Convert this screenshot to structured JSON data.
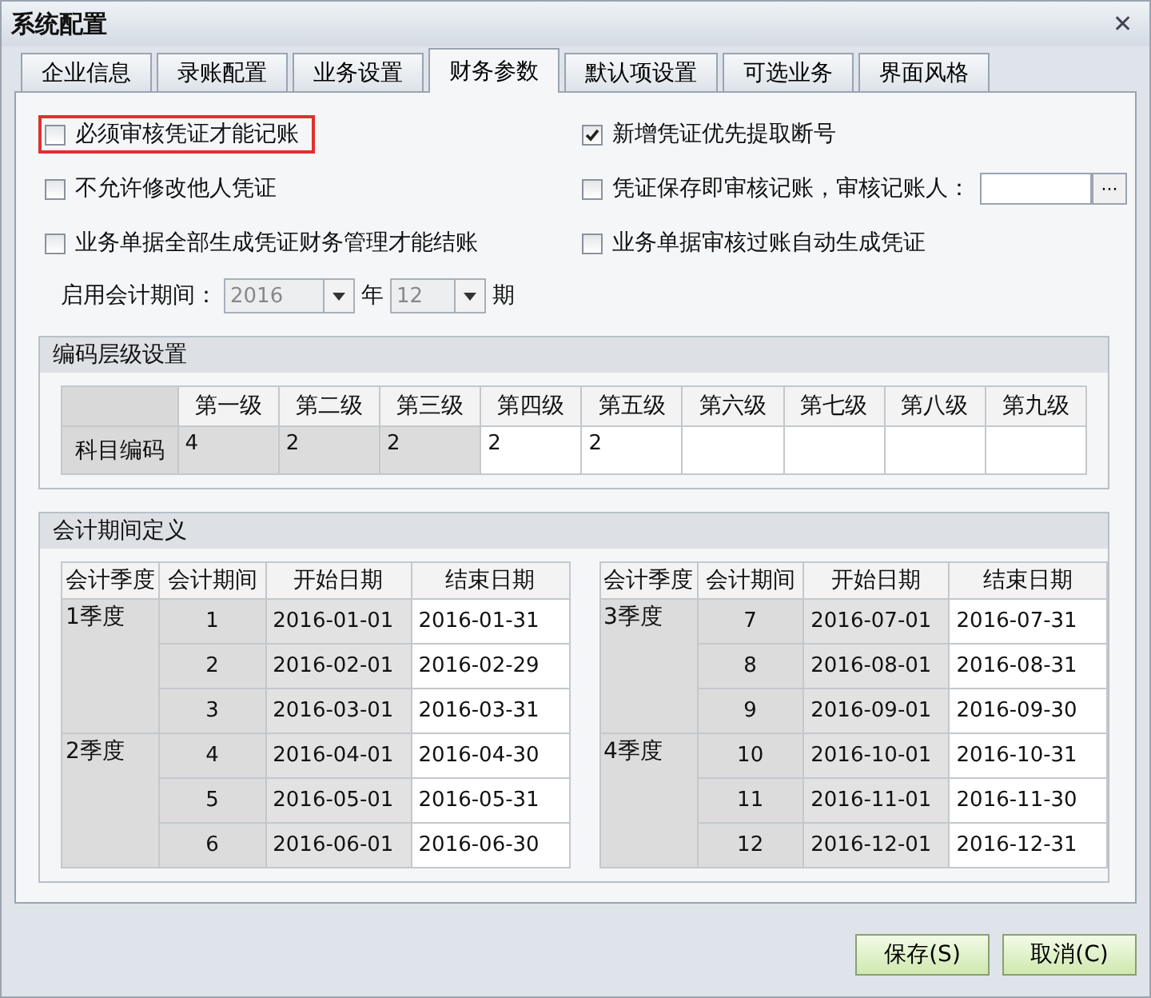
{
  "window": {
    "title": "系统配置",
    "close": "✕"
  },
  "tabs": [
    {
      "label": "企业信息",
      "selected": false
    },
    {
      "label": "录账配置",
      "selected": false
    },
    {
      "label": "业务设置",
      "selected": false
    },
    {
      "label": "财务参数",
      "selected": true
    },
    {
      "label": "默认项设置",
      "selected": false
    },
    {
      "label": "可选业务",
      "selected": false
    },
    {
      "label": "界面风格",
      "selected": false
    }
  ],
  "options": [
    {
      "kind": "checkbox",
      "label": "必须审核凭证才能记账",
      "checked": false,
      "highlighted": true
    },
    {
      "kind": "checkbox",
      "label": "新增凭证优先提取断号",
      "checked": true,
      "highlighted": false
    },
    {
      "kind": "checkbox",
      "label": "不允许修改他人凭证",
      "checked": false,
      "highlighted": false
    },
    {
      "kind": "picker",
      "label": "凭证保存即审核记账，审核记账人：",
      "checked": false,
      "highlighted": false,
      "picker_button": "···"
    },
    {
      "kind": "checkbox",
      "label": "业务单据全部生成凭证财务管理才能结账",
      "checked": false,
      "highlighted": false
    },
    {
      "kind": "checkbox",
      "label": "业务单据审核过账自动生成凭证",
      "checked": false,
      "highlighted": false
    }
  ],
  "start_period": {
    "label": "启用会计期间：",
    "year": "2016",
    "year_unit": "年",
    "month": "12",
    "month_unit": "期",
    "disabled": true
  },
  "code_levels": {
    "title": "编码层级设置",
    "columns": [
      "第一级",
      "第二级",
      "第三级",
      "第四级",
      "第五级",
      "第六级",
      "第七级",
      "第八级",
      "第九级"
    ],
    "row_label": "科目编码",
    "cells": [
      {
        "value": "4",
        "disabled": true
      },
      {
        "value": "2",
        "disabled": true
      },
      {
        "value": "2",
        "disabled": true
      },
      {
        "value": "2",
        "disabled": false
      },
      {
        "value": "2",
        "disabled": false
      },
      {
        "disabled": false
      },
      {
        "disabled": false
      },
      {
        "disabled": false
      },
      {
        "disabled": false
      }
    ]
  },
  "periods": {
    "title": "会计期间定义",
    "tables": [
      {
        "columns": [
          "会计季度",
          "会计期间",
          "开始日期",
          "结束日期"
        ],
        "quarters": [
          {
            "label": "1季度",
            "rows": [
              {
                "period": "1",
                "start": "2016-01-01",
                "end": "2016-01-31"
              },
              {
                "period": "2",
                "start": "2016-02-01",
                "end": "2016-02-29"
              },
              {
                "period": "3",
                "start": "2016-03-01",
                "end": "2016-03-31"
              }
            ]
          },
          {
            "label": "2季度",
            "rows": [
              {
                "period": "4",
                "start": "2016-04-01",
                "end": "2016-04-30"
              },
              {
                "period": "5",
                "start": "2016-05-01",
                "end": "2016-05-31"
              },
              {
                "period": "6",
                "start": "2016-06-01",
                "end": "2016-06-30"
              }
            ]
          }
        ]
      },
      {
        "columns": [
          "会计季度",
          "会计期间",
          "开始日期",
          "结束日期"
        ],
        "quarters": [
          {
            "label": "3季度",
            "rows": [
              {
                "period": "7",
                "start": "2016-07-01",
                "end": "2016-07-31"
              },
              {
                "period": "8",
                "start": "2016-08-01",
                "end": "2016-08-31"
              },
              {
                "period": "9",
                "start": "2016-09-01",
                "end": "2016-09-30"
              }
            ]
          },
          {
            "label": "4季度",
            "rows": [
              {
                "period": "10",
                "start": "2016-10-01",
                "end": "2016-10-31"
              },
              {
                "period": "11",
                "start": "2016-11-01",
                "end": "2016-11-30"
              },
              {
                "period": "12",
                "start": "2016-12-01",
                "end": "2016-12-31"
              }
            ]
          }
        ]
      }
    ]
  },
  "buttons": [
    "保存(S)",
    "取消(C)"
  ]
}
